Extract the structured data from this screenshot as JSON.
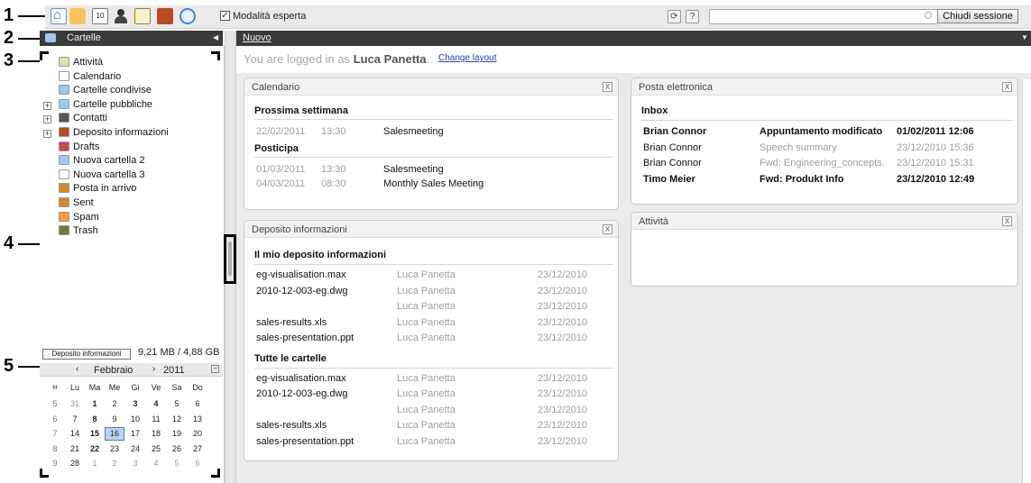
{
  "toolbar": {
    "expert_mode_label": "Modalità esperta",
    "calendar_icon_text": "10",
    "logout_label": "Chiudi sessione",
    "refresh_glyph": "⟳",
    "help_glyph": "?"
  },
  "annotations": [
    "1",
    "2",
    "3",
    "4",
    "5"
  ],
  "sidebar": {
    "title": "Cartelle",
    "items": [
      {
        "label": "Attività",
        "icon": "task-icon",
        "expandable": false
      },
      {
        "label": "Calendario",
        "icon": "calendar-icon",
        "expandable": false
      },
      {
        "label": "Cartelle condivise",
        "icon": "shared-folder-icon",
        "expandable": false
      },
      {
        "label": "Cartelle pubbliche",
        "icon": "public-folder-icon",
        "expandable": true
      },
      {
        "label": "Contatti",
        "icon": "contacts-icon",
        "expandable": true
      },
      {
        "label": "Deposito informazioni",
        "icon": "infostore-icon",
        "expandable": true
      },
      {
        "label": "Drafts",
        "icon": "drafts-icon",
        "expandable": false
      },
      {
        "label": "Nuova cartella 2",
        "icon": "folder-icon",
        "expandable": false
      },
      {
        "label": "Nuova cartella 3",
        "icon": "calendar-icon",
        "expandable": false
      },
      {
        "label": "Posta in arrivo",
        "icon": "inbox-icon",
        "expandable": false
      },
      {
        "label": "Sent",
        "icon": "sent-icon",
        "expandable": false
      },
      {
        "label": "Spam",
        "icon": "spam-icon",
        "expandable": false
      },
      {
        "label": "Trash",
        "icon": "trash-icon",
        "expandable": false
      }
    ],
    "quota_button": "Deposito informazioni",
    "quota_text": "9,21 MB / 4,88 GB"
  },
  "minical": {
    "month": "Febbraio",
    "year": "2011",
    "prev": "‹",
    "next": "›",
    "weekdays": [
      "Lu",
      "Ma",
      "Me",
      "Gi",
      "Ve",
      "Sa",
      "Do"
    ],
    "weeks": [
      {
        "wk": "5",
        "days": [
          "31",
          "1",
          "2",
          "3",
          "4",
          "5",
          "6"
        ]
      },
      {
        "wk": "6",
        "days": [
          "7",
          "8",
          "9",
          "10",
          "11",
          "12",
          "13"
        ]
      },
      {
        "wk": "7",
        "days": [
          "14",
          "15",
          "16",
          "17",
          "18",
          "19",
          "20"
        ]
      },
      {
        "wk": "8",
        "days": [
          "21",
          "22",
          "23",
          "24",
          "25",
          "26",
          "27"
        ]
      },
      {
        "wk": "9",
        "days": [
          "28",
          "1",
          "2",
          "3",
          "4",
          "5",
          "6"
        ]
      }
    ],
    "selected": "16"
  },
  "main": {
    "header_title": "Nuovo",
    "welcome_prefix": "You are logged in as",
    "user": "Luca Panetta",
    "change_layout": "Change layout"
  },
  "calendar_portlet": {
    "title": "Calendario",
    "close": "X",
    "sections": [
      {
        "title": "Prossima settimana",
        "rows": [
          [
            "22/02/2011",
            "13:30",
            "Salesmeeting"
          ]
        ]
      },
      {
        "title": "Posticipa",
        "rows": [
          [
            "01/03/2011",
            "13:30",
            "Salesmeeting"
          ],
          [
            "04/03/2011",
            "08:30",
            "Monthly Sales Meeting"
          ]
        ]
      }
    ]
  },
  "infostore_portlet": {
    "title": "Deposito informazioni",
    "close": "X",
    "sections": [
      {
        "title": "Il mio deposito informazioni",
        "rows": [
          [
            "eg-visualisation.max",
            "Luca Panetta",
            "23/12/2010"
          ],
          [
            "2010-12-003-eg.dwg",
            "Luca Panetta",
            "23/12/2010"
          ],
          [
            "",
            "Luca Panetta",
            "23/12/2010"
          ],
          [
            "sales-results.xls",
            "Luca Panetta",
            "23/12/2010"
          ],
          [
            "sales-presentation.ppt",
            "Luca Panetta",
            "23/12/2010"
          ]
        ]
      },
      {
        "title": "Tutte le cartelle",
        "rows": [
          [
            "eg-visualisation.max",
            "Luca Panetta",
            "23/12/2010"
          ],
          [
            "2010-12-003-eg.dwg",
            "Luca Panetta",
            "23/12/2010"
          ],
          [
            "",
            "Luca Panetta",
            "23/12/2010"
          ],
          [
            "sales-results.xls",
            "Luca Panetta",
            "23/12/2010"
          ],
          [
            "sales-presentation.ppt",
            "Luca Panetta",
            "23/12/2010"
          ]
        ]
      }
    ]
  },
  "mail_portlet": {
    "title": "Posta elettronica",
    "close": "X",
    "section_title": "Inbox",
    "rows": [
      {
        "from": "Brian Connor",
        "subject": "Appuntamento modificato",
        "date": "01/02/2011 12:06",
        "unread": true
      },
      {
        "from": "Brian Connor",
        "subject": "Speech summary",
        "date": "23/12/2010 15:36",
        "unread": false
      },
      {
        "from": "Brian Connor",
        "subject": "Fwd: Engineering_concepts.",
        "date": "23/12/2010 15:31",
        "unread": false
      },
      {
        "from": "Timo Meier",
        "subject": "Fwd: Produkt Info",
        "date": "23/12/2010 12:49",
        "unread": true
      }
    ]
  },
  "tasks_portlet": {
    "title": "Attività",
    "close": "X"
  }
}
